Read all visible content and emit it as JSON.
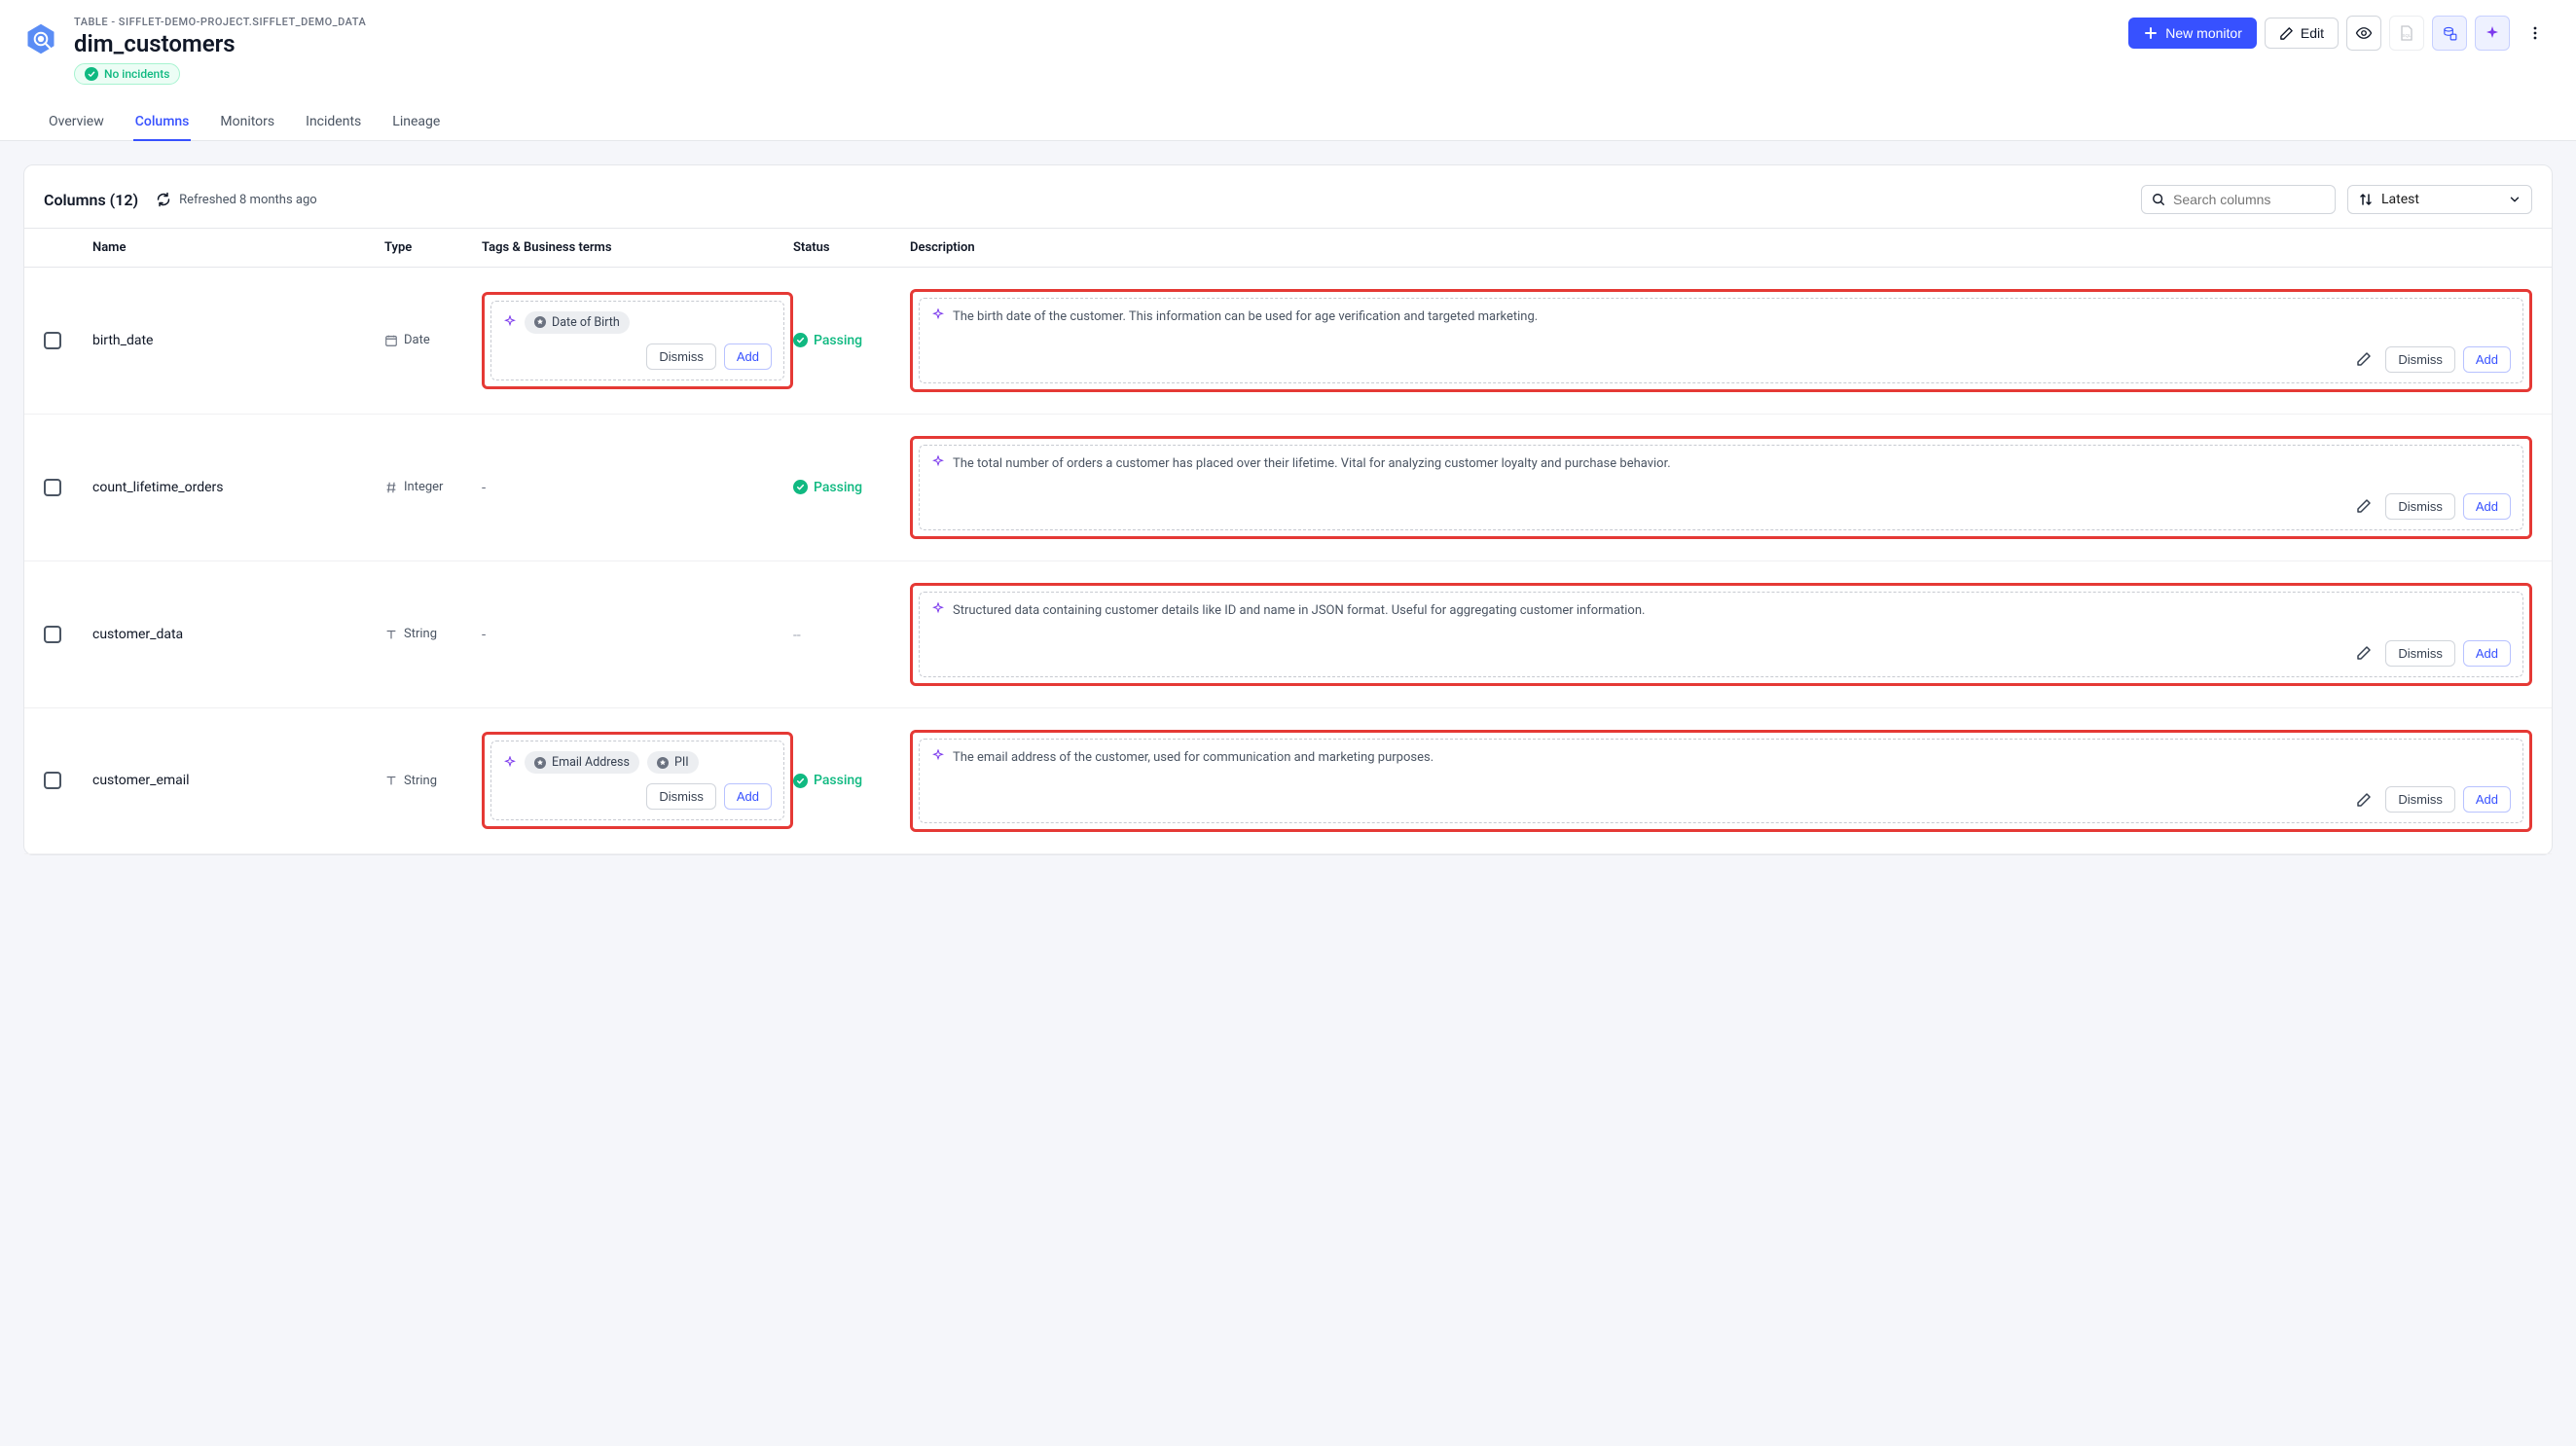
{
  "header": {
    "breadcrumb": "TABLE - SIFFLET-DEMO-PROJECT.SIFFLET_DEMO_DATA",
    "title": "dim_customers",
    "badge": "No incidents",
    "new_monitor": "New monitor",
    "edit": "Edit"
  },
  "tabs": {
    "overview": "Overview",
    "columns": "Columns",
    "monitors": "Monitors",
    "incidents": "Incidents",
    "lineage": "Lineage"
  },
  "panel": {
    "title": "Columns (12)",
    "refreshed": "Refreshed 8 months ago",
    "search_placeholder": "Search columns",
    "sort_label": "Latest"
  },
  "thead": {
    "name": "Name",
    "type": "Type",
    "tags": "Tags & Business terms",
    "status": "Status",
    "description": "Description"
  },
  "labels": {
    "dismiss": "Dismiss",
    "add": "Add",
    "passing": "Passing"
  },
  "rows": [
    {
      "name": "birth_date",
      "type": "Date",
      "type_icon": "calendar",
      "tags": [
        "Date of Birth"
      ],
      "status": "passing",
      "description": "The birth date of the customer. This information can be used for age verification and targeted marketing."
    },
    {
      "name": "count_lifetime_orders",
      "type": "Integer",
      "type_icon": "hash",
      "tags_text": "-",
      "status": "passing",
      "description": "The total number of orders a customer has placed over their lifetime. Vital for analyzing customer loyalty and purchase behavior."
    },
    {
      "name": "customer_data",
      "type": "String",
      "type_icon": "text",
      "tags_text": "-",
      "status_text": "--",
      "description": "Structured data containing customer details like ID and name in JSON format. Useful for aggregating customer information."
    },
    {
      "name": "customer_email",
      "type": "String",
      "type_icon": "text",
      "tags": [
        "Email Address",
        "PII"
      ],
      "status": "passing",
      "description": "The email address of the customer, used for communication and marketing purposes."
    }
  ]
}
